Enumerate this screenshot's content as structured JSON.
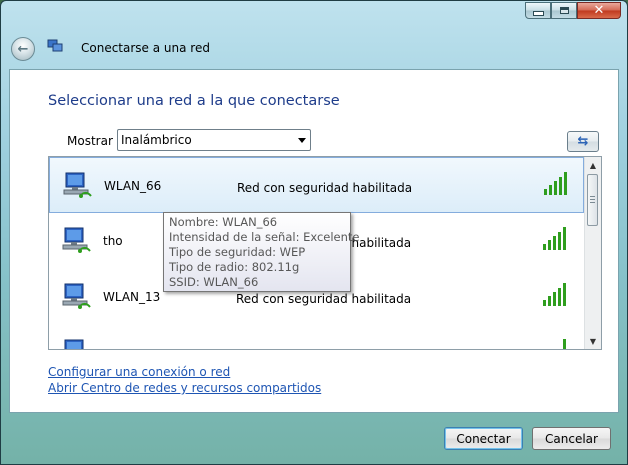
{
  "window": {
    "title": "Conectarse a una red",
    "buttons": {
      "minimize": "minimize-icon",
      "maximize": "maximize-icon",
      "close": "close-icon"
    }
  },
  "main": {
    "heading": "Seleccionar una red a la que conectarse",
    "filter": {
      "label": "Mostrar",
      "selected": "Inalámbrico"
    },
    "networks": [
      {
        "name": "WLAN_66",
        "status": "Red con seguridad habilitada",
        "selected": true
      },
      {
        "name": "tho",
        "status": "Red con seguridad habilitada",
        "selected": false
      },
      {
        "name": "WLAN_13",
        "status": "Red con seguridad habilitada",
        "selected": false
      },
      {
        "name": "",
        "status": "",
        "selected": false
      }
    ],
    "tooltip": {
      "line1": "Nombre: WLAN_66",
      "line2": "Intensidad de la señal: Excelente",
      "line3": "Tipo de seguridad: WEP",
      "line4": "Tipo de radio: 802.11g",
      "line5": "SSID: WLAN_66"
    },
    "links": {
      "configure": "Configurar una conexión o red",
      "network_center": "Abrir Centro de redes y recursos compartidos"
    }
  },
  "footer": {
    "connect_label": "Conectar",
    "cancel_label": "Cancelar"
  },
  "colors": {
    "heading": "#1e3c8a",
    "link": "#1e55b3",
    "signal": "#2f9e1e",
    "selected_row": "#dcedf9"
  }
}
